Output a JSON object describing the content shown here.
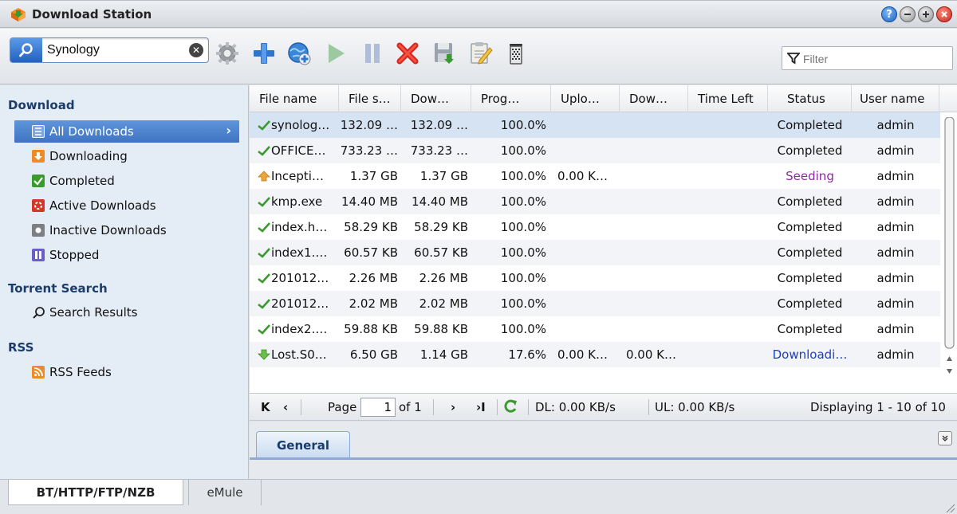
{
  "window": {
    "title": "Download Station",
    "icon": "download-station-icon",
    "controls": [
      "help-icon",
      "minimize-icon",
      "maximize-icon",
      "close-icon"
    ]
  },
  "toolbar": {
    "search_value": "Synology",
    "filter_placeholder": "Filter",
    "buttons": [
      "settings",
      "create",
      "add-url",
      "resume",
      "pause",
      "delete",
      "save-as",
      "edit",
      "clear-completed"
    ]
  },
  "sidebar": {
    "download_header": "Download",
    "items": [
      {
        "label": "All Downloads",
        "icon": "list-icon",
        "color": "#4a7fd0"
      },
      {
        "label": "Downloading",
        "icon": "downloading-icon",
        "color": "#f08a24"
      },
      {
        "label": "Completed",
        "icon": "completed-icon",
        "color": "#3a9a2e"
      },
      {
        "label": "Active Downloads",
        "icon": "active-icon",
        "color": "#d8342a"
      },
      {
        "label": "Inactive Downloads",
        "icon": "inactive-icon",
        "color": "#7d7f82"
      },
      {
        "label": "Stopped",
        "icon": "stopped-icon",
        "color": "#6a5fc8"
      }
    ],
    "torrent_header": "Torrent Search",
    "search_results": "Search Results",
    "rss_header": "RSS",
    "rss_feeds": "RSS Feeds"
  },
  "grid": {
    "columns": [
      "File name",
      "File s…",
      "Dow…",
      "Prog…",
      "Uplo…",
      "Dow…",
      "Time Left",
      "Status",
      "User name"
    ],
    "rows": [
      {
        "name": "synolog…",
        "size": "132.09 …",
        "downloaded": "132.09 …",
        "progress": "100.0%",
        "upload": "",
        "download": "",
        "time_left": "",
        "status": "Completed",
        "user": "admin",
        "icon": "check-icon"
      },
      {
        "name": "OFFICE…",
        "size": "733.23 …",
        "downloaded": "733.23 …",
        "progress": "100.0%",
        "upload": "",
        "download": "",
        "time_left": "",
        "status": "Completed",
        "user": "admin",
        "icon": "check-icon"
      },
      {
        "name": "Incepti…",
        "size": "1.37 GB",
        "downloaded": "1.37 GB",
        "progress": "100.0%",
        "upload": "0.00 K…",
        "download": "",
        "time_left": "",
        "status": "Seeding",
        "user": "admin",
        "icon": "seeding-icon"
      },
      {
        "name": "kmp.exe",
        "size": "14.40 MB",
        "downloaded": "14.40 MB",
        "progress": "100.0%",
        "upload": "",
        "download": "",
        "time_left": "",
        "status": "Completed",
        "user": "admin",
        "icon": "check-icon"
      },
      {
        "name": "index.h…",
        "size": "58.29 KB",
        "downloaded": "58.29 KB",
        "progress": "100.0%",
        "upload": "",
        "download": "",
        "time_left": "",
        "status": "Completed",
        "user": "admin",
        "icon": "check-icon"
      },
      {
        "name": "index1.…",
        "size": "60.57 KB",
        "downloaded": "60.57 KB",
        "progress": "100.0%",
        "upload": "",
        "download": "",
        "time_left": "",
        "status": "Completed",
        "user": "admin",
        "icon": "check-icon"
      },
      {
        "name": "201012…",
        "size": "2.26 MB",
        "downloaded": "2.26 MB",
        "progress": "100.0%",
        "upload": "",
        "download": "",
        "time_left": "",
        "status": "Completed",
        "user": "admin",
        "icon": "check-icon"
      },
      {
        "name": "201012…",
        "size": "2.02 MB",
        "downloaded": "2.02 MB",
        "progress": "100.0%",
        "upload": "",
        "download": "",
        "time_left": "",
        "status": "Completed",
        "user": "admin",
        "icon": "check-icon"
      },
      {
        "name": "index2.…",
        "size": "59.88 KB",
        "downloaded": "59.88 KB",
        "progress": "100.0%",
        "upload": "",
        "download": "",
        "time_left": "",
        "status": "Completed",
        "user": "admin",
        "icon": "check-icon"
      },
      {
        "name": "Lost.S0…",
        "size": "6.50 GB",
        "downloaded": "1.14 GB",
        "progress": "17.6%",
        "upload": "0.00 K…",
        "download": "0.00 K…",
        "time_left": "",
        "status": "Downloadi…",
        "user": "admin",
        "icon": "downloading-arrow-icon"
      }
    ],
    "status_colors": {
      "Completed": "#111111",
      "Seeding": "#8a2a9e",
      "Downloadi…": "#1f3fb8"
    }
  },
  "pager": {
    "page_label": "Page",
    "page_value": "1",
    "of_label": "of 1",
    "dl_speed": "DL: 0.00 KB/s",
    "ul_speed": "UL: 0.00 KB/s",
    "displaying": "Displaying 1 - 10 of 10"
  },
  "detail": {
    "tab_general": "General"
  },
  "bottom_tabs": {
    "bt": "BT/HTTP/FTP/NZB",
    "emule": "eMule"
  }
}
